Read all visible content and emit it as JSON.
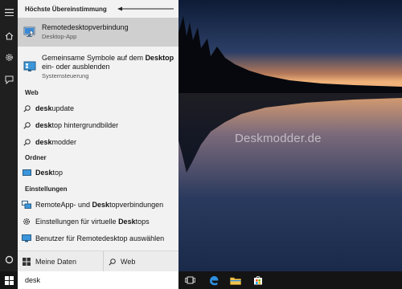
{
  "colors": {
    "accent": "#0078d7",
    "panel_bg": "#f2f2f2",
    "highlight": "#cfcfcf",
    "rail_bg": "#1f1f1f"
  },
  "watermark": "Deskmodder.de",
  "rail": {
    "icons": [
      "hamburger-icon",
      "home-icon",
      "gear-icon",
      "feedback-icon",
      "cortana-icon",
      "windows-start-icon"
    ]
  },
  "search": {
    "best_match_heading": "Höchste Übereinstimmung",
    "best_match": {
      "title": "Remotedesktopverbindung",
      "subtitle": "Desktop-App",
      "icon": "remote-desktop-icon"
    },
    "control_panel_item": {
      "line1_prefix": "Gemeinsame Symbole auf dem ",
      "line1_bold": "Desktop",
      "line2": "ein- oder ausblenden",
      "subtitle": "Systemsteuerung",
      "icon": "desktop-icons-icon"
    },
    "web_heading": "Web",
    "web_items": [
      {
        "bold": "desk",
        "rest": "update"
      },
      {
        "bold": "desk",
        "rest": "top hintergrundbilder"
      },
      {
        "bold": "desk",
        "rest": "modder"
      }
    ],
    "folder_heading": "Ordner",
    "folder_item": {
      "bold": "Desk",
      "rest": "top"
    },
    "settings_heading": "Einstellungen",
    "settings_items": [
      {
        "pre": "RemoteApp- und ",
        "bold": "Desk",
        "rest": "topverbindungen",
        "icon": "remoteapp-icon"
      },
      {
        "pre": "Einstellungen für virtuelle ",
        "bold": "Desk",
        "rest": "tops",
        "icon": "gear-icon"
      },
      {
        "pre": "Benutzer für Remotedesktop auswählen",
        "bold": "",
        "rest": "",
        "icon": "monitor-icon"
      }
    ],
    "tab_my_data": "Meine Daten",
    "tab_web": "Web",
    "query": "desk"
  },
  "taskbar": {
    "icons": [
      "task-view-icon",
      "edge-icon",
      "file-explorer-icon",
      "store-icon"
    ]
  }
}
